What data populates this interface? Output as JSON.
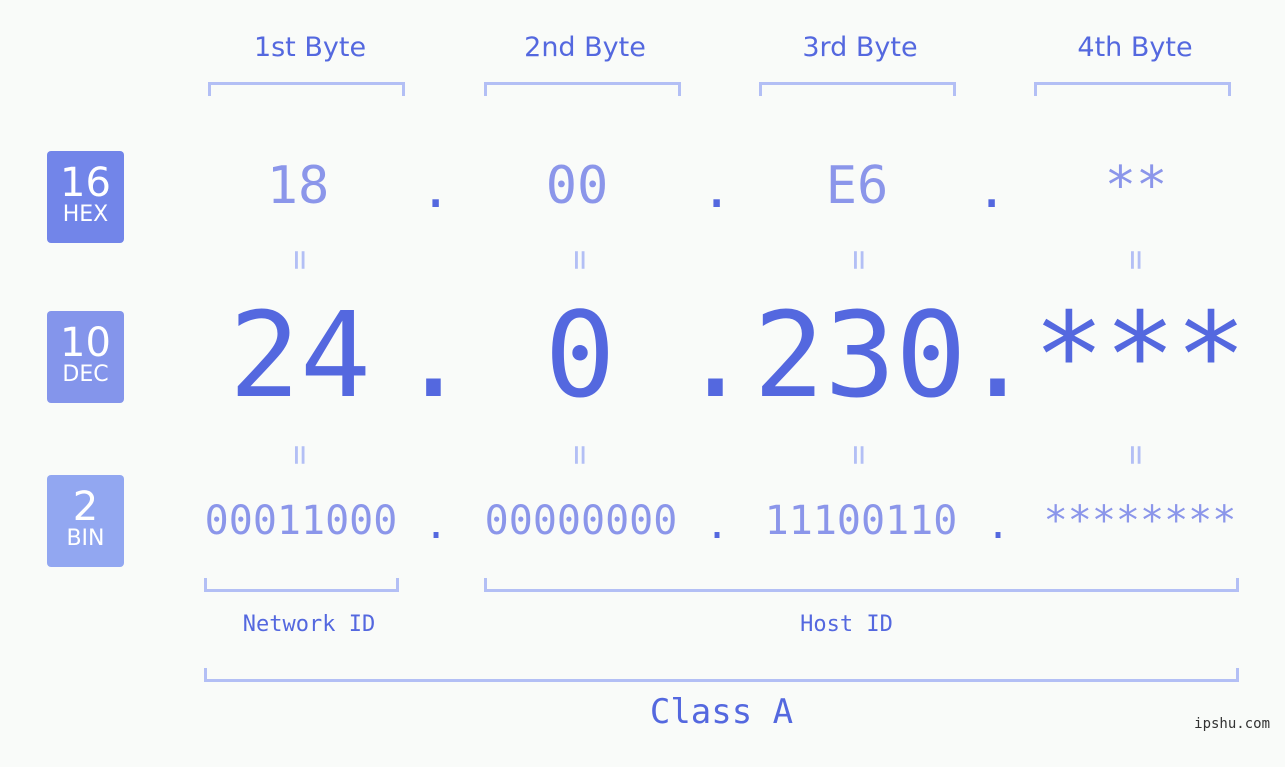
{
  "byte_headers": [
    "1st Byte",
    "2nd Byte",
    "3rd Byte",
    "4th Byte"
  ],
  "badges": [
    {
      "number": "16",
      "label": "HEX",
      "color": "#7285e9"
    },
    {
      "number": "10",
      "label": "DEC",
      "color": "#8495eb"
    },
    {
      "number": "2",
      "label": "BIN",
      "color": "#92a7f1"
    }
  ],
  "hex": {
    "octets": [
      "18",
      "00",
      "E6",
      "**"
    ],
    "separator": "."
  },
  "dec": {
    "octets": [
      "24",
      "0",
      "230",
      "***"
    ],
    "separator": "."
  },
  "bin": {
    "octets": [
      "00011000",
      "00000000",
      "11100110",
      "********"
    ],
    "separator": "."
  },
  "equals_sign": "=",
  "network_label": "Network ID",
  "host_label": "Host ID",
  "class_label": "Class A",
  "watermark": "ipshu.com",
  "colors": {
    "primary": "#5468df",
    "light_text": "#8b96ea",
    "bracket": "#b3bff5",
    "background": "#f9fbf9"
  }
}
